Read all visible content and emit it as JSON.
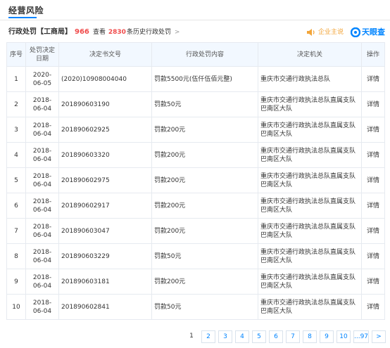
{
  "section": {
    "title": "经营风险"
  },
  "subheader": {
    "title": "行政处罚【工商局】",
    "count": "966",
    "history_prefix": "查看",
    "history_count": "2830",
    "history_suffix": "条历史行政处罚",
    "history_arrow": ">",
    "owner_label": "企业主说",
    "brand_label": "天眼查"
  },
  "table": {
    "headers": [
      "序号",
      "处罚决定日期",
      "决定书文号",
      "行政处罚内容",
      "决定机关",
      "操作"
    ],
    "rows": [
      {
        "idx": "1",
        "date": "2020-06-05",
        "doc": "(2020)10908004040",
        "content": "罚款5500元(伍仟伍佰元整)",
        "org": "重庆市交通行政执法总队",
        "op": "详情"
      },
      {
        "idx": "2",
        "date": "2018-06-04",
        "doc": "201890603190",
        "content": "罚款50元",
        "org": "重庆市交通行政执法总队直属支队巴南区大队",
        "op": "详情"
      },
      {
        "idx": "3",
        "date": "2018-06-04",
        "doc": "201890602925",
        "content": "罚款200元",
        "org": "重庆市交通行政执法总队直属支队巴南区大队",
        "op": "详情"
      },
      {
        "idx": "4",
        "date": "2018-06-04",
        "doc": "201890603320",
        "content": "罚款200元",
        "org": "重庆市交通行政执法总队直属支队巴南区大队",
        "op": "详情"
      },
      {
        "idx": "5",
        "date": "2018-06-04",
        "doc": "201890602975",
        "content": "罚款200元",
        "org": "重庆市交通行政执法总队直属支队巴南区大队",
        "op": "详情"
      },
      {
        "idx": "6",
        "date": "2018-06-04",
        "doc": "201890602917",
        "content": "罚款200元",
        "org": "重庆市交通行政执法总队直属支队巴南区大队",
        "op": "详情"
      },
      {
        "idx": "7",
        "date": "2018-06-04",
        "doc": "201890603047",
        "content": "罚款200元",
        "org": "重庆市交通行政执法总队直属支队巴南区大队",
        "op": "详情"
      },
      {
        "idx": "8",
        "date": "2018-06-04",
        "doc": "201890603229",
        "content": "罚款50元",
        "org": "重庆市交通行政执法总队直属支队巴南区大队",
        "op": "详情"
      },
      {
        "idx": "9",
        "date": "2018-06-04",
        "doc": "201890603181",
        "content": "罚款200元",
        "org": "重庆市交通行政执法总队直属支队巴南区大队",
        "op": "详情"
      },
      {
        "idx": "10",
        "date": "2018-06-04",
        "doc": "201890602841",
        "content": "罚款50元",
        "org": "重庆市交通行政执法总队直属支队巴南区大队",
        "op": "详情"
      }
    ]
  },
  "pagination": {
    "current": "1",
    "pages": [
      "2",
      "3",
      "4",
      "5",
      "6",
      "7",
      "8",
      "9",
      "10"
    ],
    "more": "...97",
    "next": ">"
  },
  "colors": {
    "accent": "#0084ff",
    "danger": "#f04b4b",
    "owner": "#f2a53a",
    "header_bg": "#f2f8ff"
  },
  "icons": {
    "owner": "megaphone-icon",
    "brand": "tianyancha-logo-icon"
  }
}
